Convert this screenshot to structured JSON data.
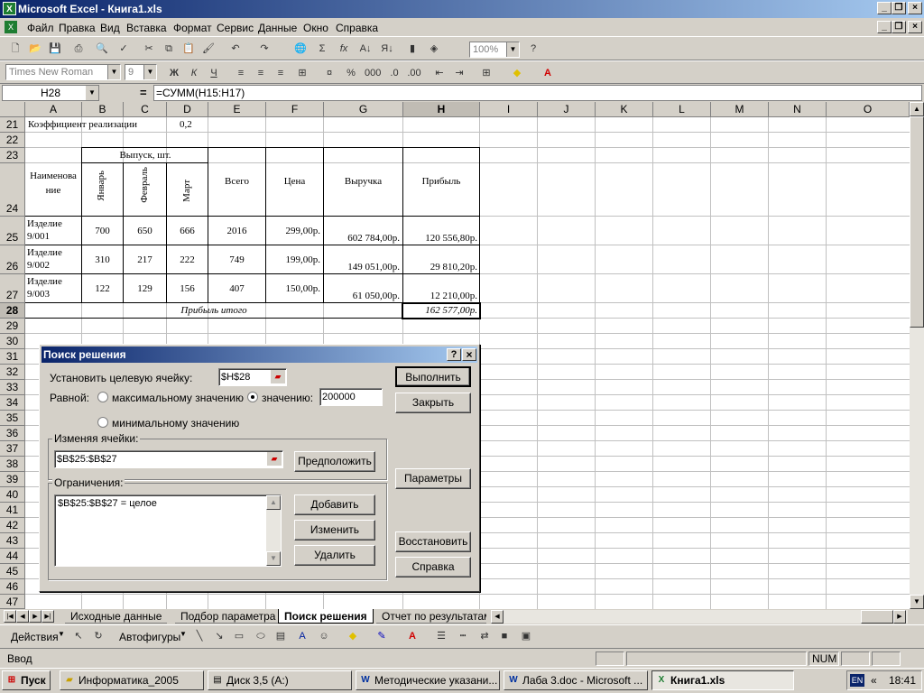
{
  "window": {
    "title": "Microsoft Excel - Книга1.xls"
  },
  "menu": [
    "Файл",
    "Правка",
    "Вид",
    "Вставка",
    "Формат",
    "Сервис",
    "Данные",
    "Окно",
    "Справка"
  ],
  "toolbar": {
    "zoom": "100%",
    "font": "Times New Roman",
    "font_size": "9"
  },
  "formula_bar": {
    "name_box": "H28",
    "equals": "=",
    "formula": "=СУММ(H15:H17)"
  },
  "columns": [
    "A",
    "B",
    "C",
    "D",
    "E",
    "F",
    "G",
    "H",
    "I",
    "J",
    "K",
    "L",
    "M",
    "N",
    "O"
  ],
  "rows": [
    "21",
    "22",
    "23",
    "24",
    "25",
    "26",
    "27",
    "28",
    "29",
    "30",
    "31",
    "32",
    "33",
    "34",
    "35",
    "36",
    "37",
    "38",
    "39",
    "40",
    "41",
    "42",
    "43",
    "44",
    "45",
    "46",
    "47"
  ],
  "sheet": {
    "r21_label": "Коэффициент реализации",
    "r21_value": "0,2",
    "h_name": "Наименова ние",
    "h_output": "Выпуск, шт.",
    "h_jan": "Январь",
    "h_feb": "Февраль",
    "h_mar": "Март",
    "h_total": "Всего",
    "h_price": "Цена",
    "h_revenue": "Выручка",
    "h_profit": "Прибыль",
    "rows": [
      {
        "name": "Изделие 9/001",
        "jan": "700",
        "feb": "650",
        "mar": "666",
        "total": "2016",
        "price": "299,00р.",
        "revenue": "602 784,00р.",
        "profit": "120 556,80р."
      },
      {
        "name": "Изделие 9/002",
        "jan": "310",
        "feb": "217",
        "mar": "222",
        "total": "749",
        "price": "199,00р.",
        "revenue": "149 051,00р.",
        "profit": "29 810,20р."
      },
      {
        "name": "Изделие 9/003",
        "jan": "122",
        "feb": "129",
        "mar": "156",
        "total": "407",
        "price": "150,00р.",
        "revenue": "61 050,00р.",
        "profit": "12 210,00р."
      }
    ],
    "total_label": "Прибыль итого",
    "total_value": "162 577,00р."
  },
  "dialog": {
    "title": "Поиск решения",
    "help_q": "?",
    "close_x": "×",
    "target_label": "Установить целевую ячейку:",
    "target_value": "$H$28",
    "equal_label": "Равной:",
    "opt_max": "максимальному значению",
    "opt_value": "значению:",
    "value_input": "200000",
    "opt_min": "минимальному значению",
    "changing_label": "Изменяя ячейки:",
    "changing_value": "$B$25:$B$27",
    "guess_button": "Предположить",
    "constraints_label": "Ограничения:",
    "constraints": [
      "$B$25:$B$27 = целое"
    ],
    "add_button": "Добавить",
    "change_button": "Изменить",
    "delete_button": "Удалить",
    "solve_button": "Выполнить",
    "close_button": "Закрыть",
    "options_button": "Параметры",
    "reset_button": "Восстановить",
    "help_button": "Справка"
  },
  "tabs": [
    "Исходные данные",
    "Подбор параметра",
    "Поиск решения",
    "Отчет по результатам"
  ],
  "drawing": {
    "actions": "Действия",
    "autoshapes": "Автофигуры"
  },
  "status": {
    "mode": "Ввод",
    "num": "NUM"
  },
  "taskbar": {
    "start": "Пуск",
    "items": [
      "Информатика_2005",
      "Диск 3,5 (A:)",
      "Методические указани...",
      "Лаба 3.doc - Microsoft ...",
      "Книга1.xls"
    ],
    "lang": "EN",
    "clock": "18:41"
  },
  "colors": {
    "title_start": "#0a246a",
    "title_end": "#a6caf0",
    "face": "#d4d0c8"
  }
}
